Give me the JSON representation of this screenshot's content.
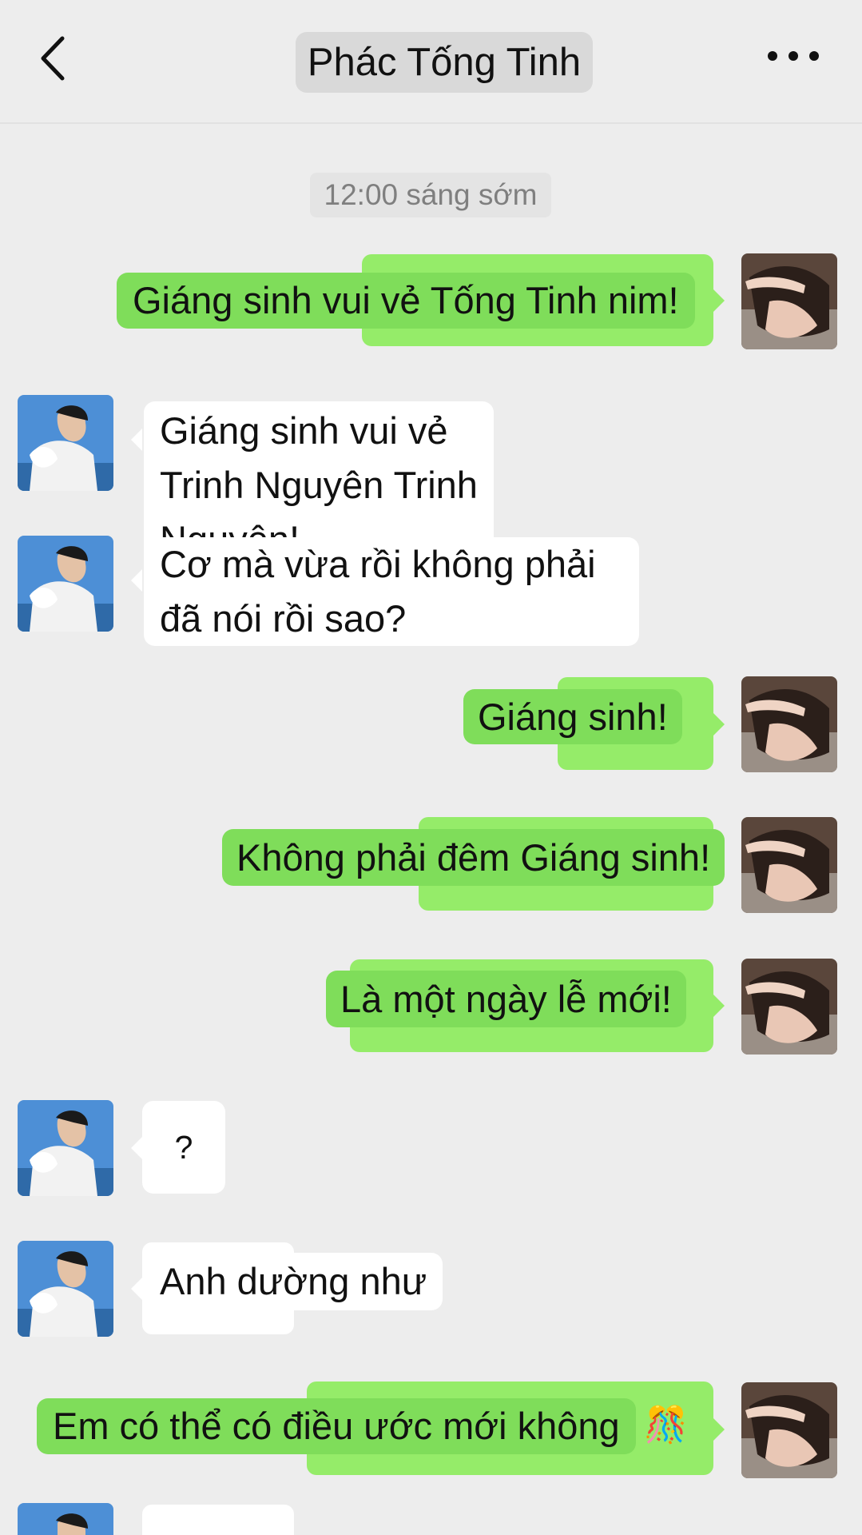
{
  "header": {
    "title": "Phác Tống Tinh",
    "back_icon": "chevron-left-icon",
    "more_icon": "more-dots-icon"
  },
  "timestamp": "12:00 sáng sớm",
  "messages": [
    {
      "side": "right",
      "text": "Giáng sinh vui vẻ Tống Tinh nim!"
    },
    {
      "side": "left",
      "text": "Giáng sinh vui vẻ Trinh Nguyên Trinh Nguyên!"
    },
    {
      "side": "left",
      "text": "Cơ mà vừa rồi không phải đã nói rồi sao?"
    },
    {
      "side": "right",
      "text": "Giáng sinh!"
    },
    {
      "side": "right",
      "text": "Không phải đêm Giáng sinh!"
    },
    {
      "side": "right",
      "text": "Là một ngày lễ mới!"
    },
    {
      "side": "left",
      "text": "?"
    },
    {
      "side": "left",
      "text": "Anh dường như"
    },
    {
      "side": "right",
      "text": "Em có thể có điều ước mới không",
      "emoji": "🎊"
    }
  ],
  "colors": {
    "background": "#ededed",
    "sent_bubble": "#95ec69",
    "sent_overlay": "#7fdd5a",
    "received_bubble": "#ffffff"
  }
}
